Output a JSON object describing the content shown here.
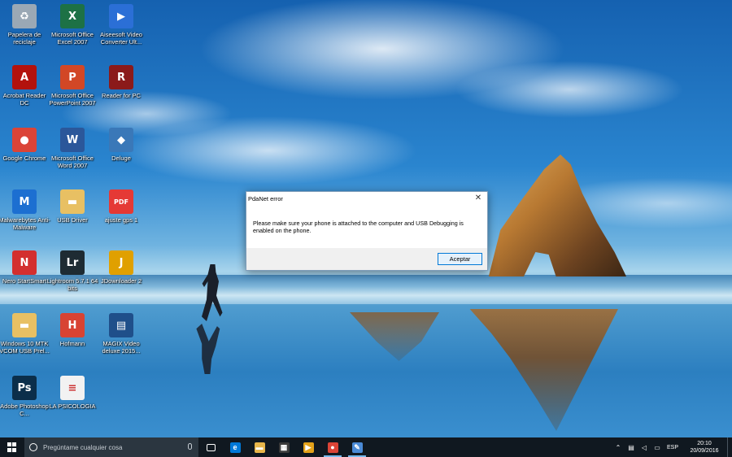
{
  "desktop": {
    "icons": [
      {
        "label": "Papelera de reciclaje",
        "icon": "recycle-bin-icon"
      },
      {
        "label": "Microsoft Office Excel 2007",
        "icon": "excel-icon"
      },
      {
        "label": "Aiseesoft Video Converter Ult...",
        "icon": "video-converter-icon"
      },
      {
        "label": "Acrobat Reader DC",
        "icon": "acrobat-icon"
      },
      {
        "label": "Microsoft Office PowerPoint 2007",
        "icon": "powerpoint-icon"
      },
      {
        "label": "Reader for PC",
        "icon": "reader-icon"
      },
      {
        "label": "Google Chrome",
        "icon": "chrome-icon"
      },
      {
        "label": "Microsoft Office Word 2007",
        "icon": "word-icon"
      },
      {
        "label": "Deluge",
        "icon": "deluge-icon"
      },
      {
        "label": "Malwarebytes Anti-Malware",
        "icon": "malwarebytes-icon"
      },
      {
        "label": "USB Driver",
        "icon": "folder-icon"
      },
      {
        "label": "ajuste gps 1",
        "icon": "pdf-icon"
      },
      {
        "label": "Nero StartSmart",
        "icon": "nero-icon"
      },
      {
        "label": "Lightroom 5.7.1 64 bits",
        "icon": "lightroom-icon"
      },
      {
        "label": "JDownloader 2",
        "icon": "jdownloader-icon"
      },
      {
        "label": "Windows 10 MTK VCOM USB Prel...",
        "icon": "folder-icon"
      },
      {
        "label": "Hofmann",
        "icon": "hofmann-icon"
      },
      {
        "label": "MAGIX Video deluxe 2015...",
        "icon": "magix-icon"
      },
      {
        "label": "Adobe Photoshop C...",
        "icon": "photoshop-icon"
      },
      {
        "label": "LA PSICOLOGIA",
        "icon": "document-icon"
      }
    ],
    "icon_glyphs": {
      "recycle-bin-icon": "♻",
      "excel-icon": "X",
      "video-converter-icon": "▶",
      "acrobat-icon": "A",
      "powerpoint-icon": "P",
      "reader-icon": "R",
      "chrome-icon": "●",
      "word-icon": "W",
      "deluge-icon": "◆",
      "malwarebytes-icon": "M",
      "folder-icon": "▬",
      "pdf-icon": "PDF",
      "nero-icon": "N",
      "lightroom-icon": "Lr",
      "jdownloader-icon": "J",
      "hofmann-icon": "H",
      "magix-icon": "▤",
      "photoshop-icon": "Ps",
      "document-icon": "≡"
    }
  },
  "dialog": {
    "title": "PdaNet error",
    "close_glyph": "✕",
    "message": "Please make sure your phone is attached to the computer and USB Debugging is enabled on the phone.",
    "ok_label": "Aceptar"
  },
  "taskbar": {
    "search_placeholder": "Pregúntame cualquier cosa",
    "pinned": [
      {
        "name": "task-view-icon",
        "glyph": "▭"
      },
      {
        "name": "edge-icon",
        "glyph": "e"
      },
      {
        "name": "file-explorer-icon",
        "glyph": "▬"
      },
      {
        "name": "store-icon",
        "glyph": "▦"
      },
      {
        "name": "media-player-icon",
        "glyph": "▶"
      },
      {
        "name": "chrome-icon",
        "glyph": "●"
      },
      {
        "name": "paint-icon",
        "glyph": "✎"
      }
    ],
    "tray": {
      "chevron": "⌃",
      "language": "ESP",
      "time": "20:10",
      "date": "20/09/2016"
    }
  },
  "colors": {
    "accent": "#0078d7",
    "taskbar_bg": "#101820"
  }
}
